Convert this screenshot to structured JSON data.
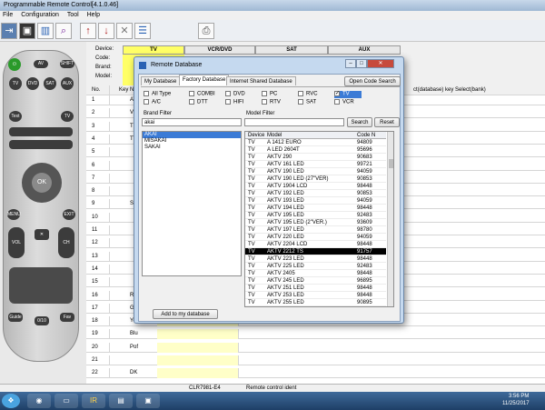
{
  "window": {
    "title": "Programmable Remote Control[4.1.0.46]"
  },
  "menu": [
    "File",
    "Configuration",
    "Tool",
    "Help"
  ],
  "device_panel": {
    "labels": [
      "Device:",
      "Code:",
      "Brand:",
      "Model:"
    ],
    "tabs": [
      "TV",
      "VCR/DVD",
      "SAT",
      "AUX"
    ]
  },
  "grid": {
    "headers": [
      "No.",
      "Key N",
      "ct(database)",
      "key Select(bank)"
    ],
    "rows": [
      {
        "n": "1",
        "k": "AV"
      },
      {
        "n": "2",
        "k": "V"
      },
      {
        "n": "3",
        "k": "TEX"
      },
      {
        "n": "4",
        "k": "TV"
      },
      {
        "n": "5",
        "k": ""
      },
      {
        "n": "6",
        "k": ""
      },
      {
        "n": "7",
        "k": ""
      },
      {
        "n": "8",
        "k": ""
      },
      {
        "n": "9",
        "k": "Subt"
      },
      {
        "n": "10",
        "k": ""
      },
      {
        "n": "11",
        "k": ""
      },
      {
        "n": "12",
        "k": ""
      },
      {
        "n": "13",
        "k": ""
      },
      {
        "n": "14",
        "k": ""
      },
      {
        "n": "15",
        "k": ""
      },
      {
        "n": "16",
        "k": "Re"
      },
      {
        "n": "17",
        "k": "Gree"
      },
      {
        "n": "18",
        "k": "Yello"
      },
      {
        "n": "19",
        "k": "Blu"
      },
      {
        "n": "20",
        "k": "Pof"
      },
      {
        "n": "21",
        "k": ""
      },
      {
        "n": "22",
        "k": "DK"
      }
    ]
  },
  "remote": {
    "keys": [
      "AV",
      "SHIFT",
      "TV",
      "DVD",
      "SAT",
      "AUX",
      "Text",
      "TV",
      "OK",
      "MENU",
      "EXIT",
      "VOL",
      "CH PAGE",
      "Guide",
      "Fav",
      "0/10"
    ]
  },
  "dialog": {
    "title": "Remote Database",
    "tabs": [
      "My Database",
      "Factory Database",
      "Internet Shared Database"
    ],
    "open_code_search": "Open Code Search",
    "types": [
      {
        "label": "All Type",
        "checked": false
      },
      {
        "label": "COMBI",
        "checked": false
      },
      {
        "label": "DVD",
        "checked": false
      },
      {
        "label": "PC",
        "checked": false
      },
      {
        "label": "RVC",
        "checked": false
      },
      {
        "label": "TV",
        "checked": true
      },
      {
        "label": "A/C",
        "checked": false
      },
      {
        "label": "DTT",
        "checked": false
      },
      {
        "label": "HIFI",
        "checked": false
      },
      {
        "label": "RTV",
        "checked": false
      },
      {
        "label": "SAT",
        "checked": false
      },
      {
        "label": "VCR",
        "checked": false
      }
    ],
    "brand_filter_label": "Brand Filter",
    "brand_filter_value": "akai",
    "model_filter_label": "Model Filter",
    "model_filter_value": "",
    "search_label": "Search",
    "reset_label": "Reset",
    "brands": [
      "AKAI",
      "MISAKAI",
      "SAKAI"
    ],
    "selected_brand": "AKAI",
    "model_columns": [
      "Device",
      "Model",
      "Code N"
    ],
    "models": [
      [
        "TV",
        "A 1412 EURO",
        "94809"
      ],
      [
        "TV",
        "A LED 2604T",
        "95696"
      ],
      [
        "TV",
        "AKTV 290",
        "90683"
      ],
      [
        "TV",
        "AKTV 161 LED",
        "99721"
      ],
      [
        "TV",
        "AKTV 190 LED",
        "94059"
      ],
      [
        "TV",
        "AKTV 190 LED (27\"VER)",
        "90853"
      ],
      [
        "TV",
        "AKTV 1904 LCD",
        "98448"
      ],
      [
        "TV",
        "AKTV 192 LED",
        "90853"
      ],
      [
        "TV",
        "AKTV 193 LED",
        "94059"
      ],
      [
        "TV",
        "AKTV 194 LED",
        "98448"
      ],
      [
        "TV",
        "AKTV 195 LED",
        "92483"
      ],
      [
        "TV",
        "AKTV 195 LED (2\"VER.)",
        "93609"
      ],
      [
        "TV",
        "AKTV 197 LED",
        "98780"
      ],
      [
        "TV",
        "AKTV 220 LED",
        "94059"
      ],
      [
        "TV",
        "AKTV 2204 LCD",
        "98448"
      ],
      [
        "TV",
        "AKTV 2212 TS",
        "91757"
      ],
      [
        "TV",
        "AKTV 223 LED",
        "98448"
      ],
      [
        "TV",
        "AKTV 225 LED",
        "92483"
      ],
      [
        "TV",
        "AKTV 2405",
        "98448"
      ],
      [
        "TV",
        "AKTV 245 LED",
        "96895"
      ],
      [
        "TV",
        "AKTV 251 LED",
        "98448"
      ],
      [
        "TV",
        "AKTV 253 LED",
        "98448"
      ],
      [
        "TV",
        "AKTV 255 LED",
        "90895"
      ]
    ],
    "selected_model_index": 15,
    "add_button": "Add to my database"
  },
  "status": {
    "code": "CLR7981-E4",
    "text": "Remote control ident"
  },
  "taskbar": {
    "time": "3:56 PM",
    "date": "11/25/2017"
  },
  "colors": {
    "tab_highlight": "#ffff66",
    "title_bar": "#a9c1dc",
    "taskbar": "#1e3f66"
  }
}
